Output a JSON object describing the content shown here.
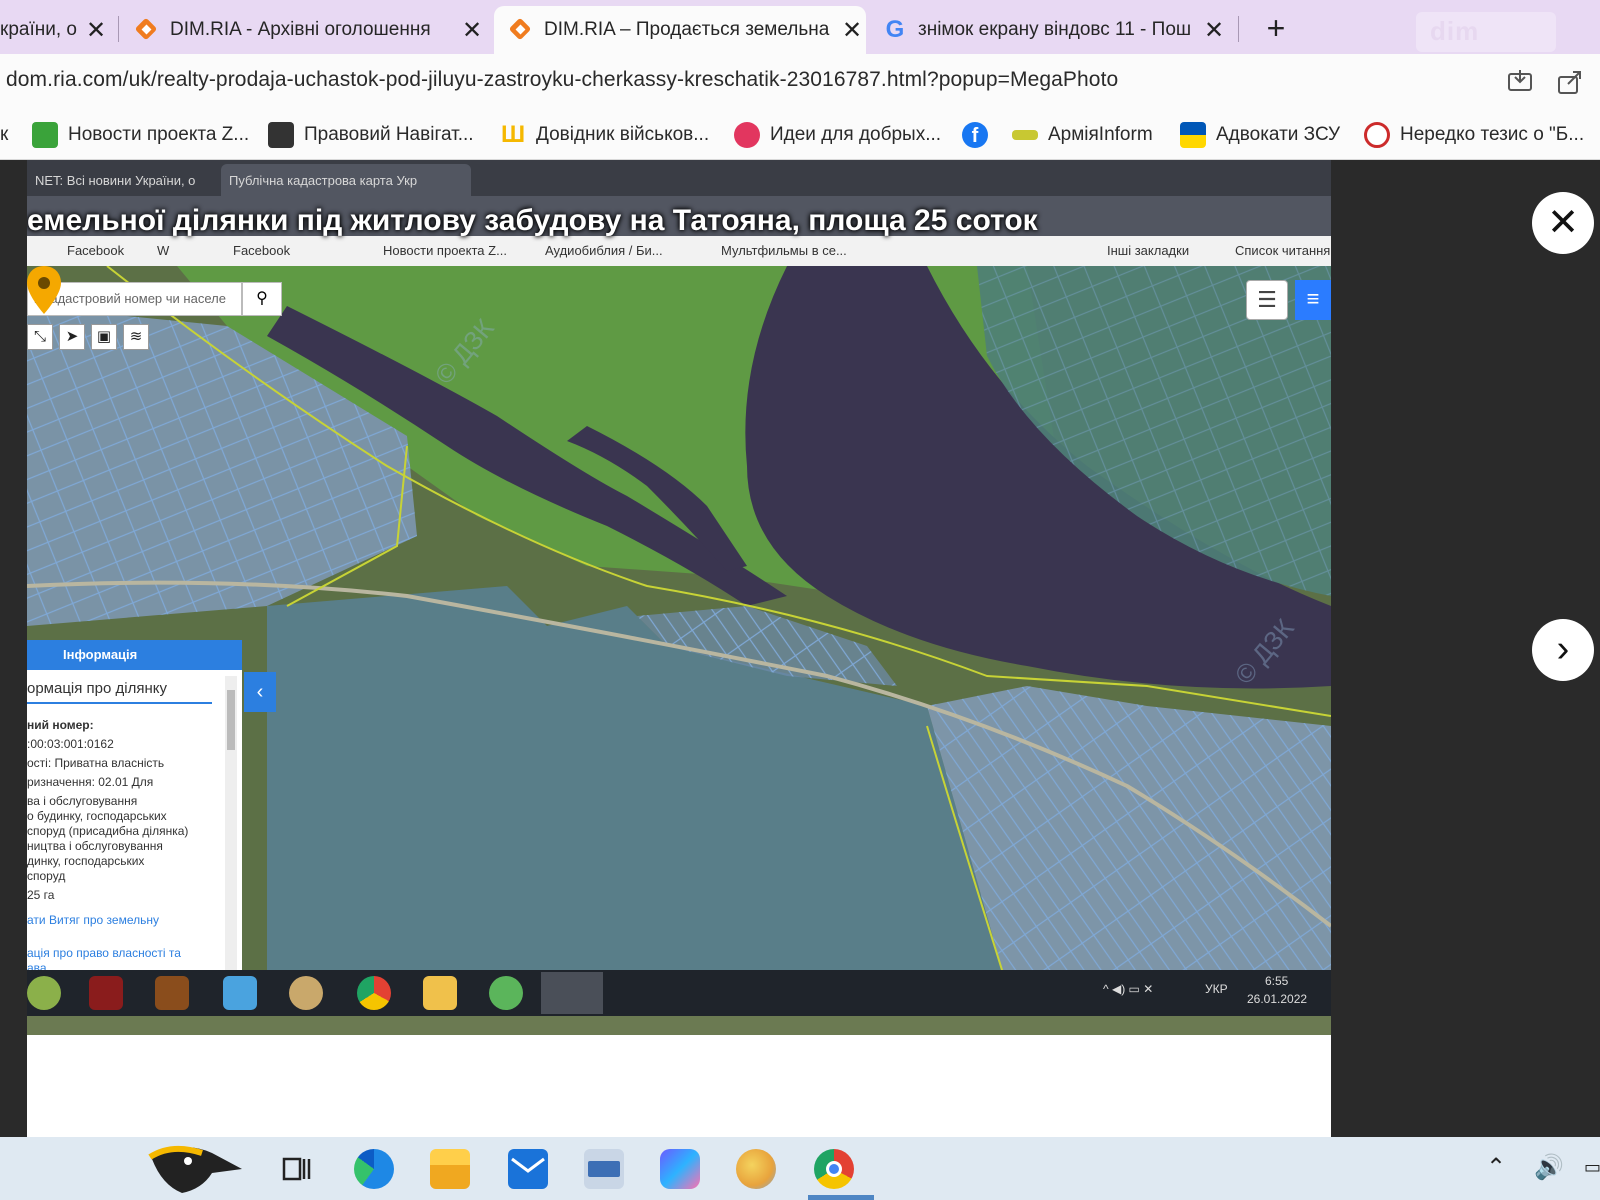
{
  "browser": {
    "tabs": [
      {
        "title": "країни, о",
        "active": false
      },
      {
        "title": "DIM.RIA - Архівні оголошення",
        "active": false
      },
      {
        "title": "DIM.RIA – Продається земельна",
        "active": true
      },
      {
        "title": "знімок екрану віндовс 11 - Пош",
        "active": false
      }
    ],
    "close_glyph": "✕",
    "new_tab_glyph": "+",
    "brand_text": "dim",
    "url": "dom.ria.com/uk/realty-prodaja-uchastok-pod-jiluyu-zastroyku-cherkassy-kreschatik-23016787.html?popup=MegaPhoto",
    "bookmarks": [
      {
        "label": "Новости проекта Z...",
        "icon": "grid-green-icon",
        "color": "#3aa33a"
      },
      {
        "label": "Правовий Навігат...",
        "icon": "navigator-icon",
        "color": "#333333"
      },
      {
        "label": "Довідник військов...",
        "icon": "trident-icon",
        "color": "#f5b800"
      },
      {
        "label": "Идеи для добрых...",
        "icon": "send-icon",
        "color": "#e2365f"
      },
      {
        "label": "",
        "icon": "facebook-icon",
        "color": "#1877f2"
      },
      {
        "label": "АрміяInform",
        "icon": "armyinform-icon",
        "color": "#c8c832"
      },
      {
        "label": "Адвокати ЗСУ",
        "icon": "ukraine-flag-icon",
        "color": "#0057b7"
      },
      {
        "label": "Нередко тезис о \"Б...",
        "icon": "nered-icon",
        "color": "#cc2b2b"
      }
    ]
  },
  "photo": {
    "overlay_title": "емельної ділянки під житлову забудову на Татояна, площа 25 соток",
    "inner_tabs": [
      {
        "title": "NET: Всі новини України, о"
      },
      {
        "title": "Публічна кадастрова карта Укр"
      }
    ],
    "inner_bookmarks": [
      "Facebook",
      "W",
      "Facebook",
      "Новости проекта Z...",
      "Аудиобиблия / Би...",
      "Мультфильмы в се...",
      "Інші закладки",
      "Список читання"
    ],
    "search_placeholder": "ь кадастровий номер чи населе",
    "info_panel": {
      "header": "Інформація",
      "subheader": "ормація про ділянку",
      "lines": [
        "ний номер:",
        ":00:03:001:0162",
        "ості: Приватна власність",
        "ризначення: 02.01 Для",
        "ва і обслуговування",
        "о будинку, господарських",
        "споруд (присадибна ділянка)",
        "ництва і обслуговування",
        "динку, господарських",
        "споруд",
        "25 га"
      ],
      "link1": "ати Витяг про земельну",
      "link2": "ація про право власності та",
      "link2b": "ава"
    },
    "taskbar_lang": "УКР",
    "taskbar_time": "6:55",
    "taskbar_date": "26.01.2022"
  },
  "viewer": {
    "close_glyph": "✕",
    "next_glyph": "›"
  },
  "windows_taskbar": {
    "apps": [
      "hornbill-widget-icon",
      "task-view-icon",
      "edge-icon",
      "file-explorer-icon",
      "mail-icon",
      "keyboard-app-icon",
      "copilot-icon",
      "paint-icon",
      "chrome-icon"
    ],
    "active_app": "chrome-icon"
  },
  "colors": {
    "tabstrip": "#e8d9f3",
    "accent_orange": "#f07c1f",
    "map_blue": "#2c7fe0",
    "pin": "#f5a800"
  }
}
